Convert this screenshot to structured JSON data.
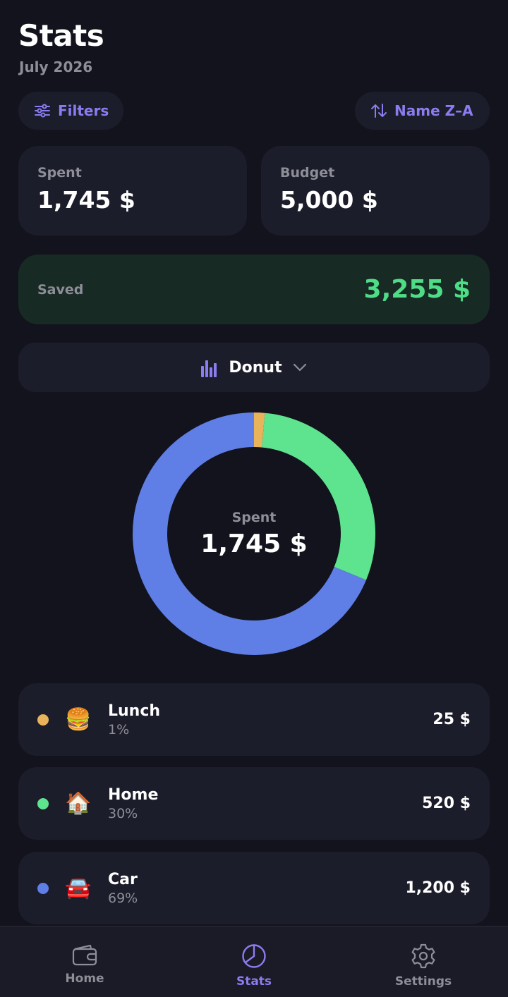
{
  "header": {
    "title": "Stats",
    "subtitle": "July 2026"
  },
  "toolbar": {
    "filters_label": "Filters",
    "sort_label": "Name Z–A"
  },
  "summary": {
    "spent_label": "Spent",
    "spent_value": "1,745 $",
    "budget_label": "Budget",
    "budget_value": "5,000 $",
    "saved_label": "Saved",
    "saved_value": "3,255 $"
  },
  "chart_selector": {
    "label": "Donut"
  },
  "colors": {
    "accent": "#8c7cf0",
    "saved": "#4fdc86",
    "lunch": "#e8b35a",
    "home": "#5ee48f",
    "car": "#5f7ee6"
  },
  "chart_data": {
    "type": "pie",
    "categories": [
      "Lunch",
      "Home",
      "Car"
    ],
    "values": [
      25,
      520,
      1200
    ],
    "colors": [
      "#e8b35a",
      "#5ee48f",
      "#5f7ee6"
    ],
    "center_label": "Spent",
    "center_value": "1,745 $"
  },
  "categories": [
    {
      "name": "Lunch",
      "percent": "1%",
      "amount": "25 $",
      "emoji": "🍔",
      "color": "#e8b35a"
    },
    {
      "name": "Home",
      "percent": "30%",
      "amount": "520 $",
      "emoji": "🏠",
      "color": "#5ee48f"
    },
    {
      "name": "Car",
      "percent": "69%",
      "amount": "1,200 $",
      "emoji": "🚘",
      "color": "#5f7ee6"
    }
  ],
  "tabbar": [
    {
      "label": "Home",
      "icon": "wallet-icon"
    },
    {
      "label": "Stats",
      "icon": "pie-chart-icon"
    },
    {
      "label": "Settings",
      "icon": "gear-icon"
    }
  ]
}
